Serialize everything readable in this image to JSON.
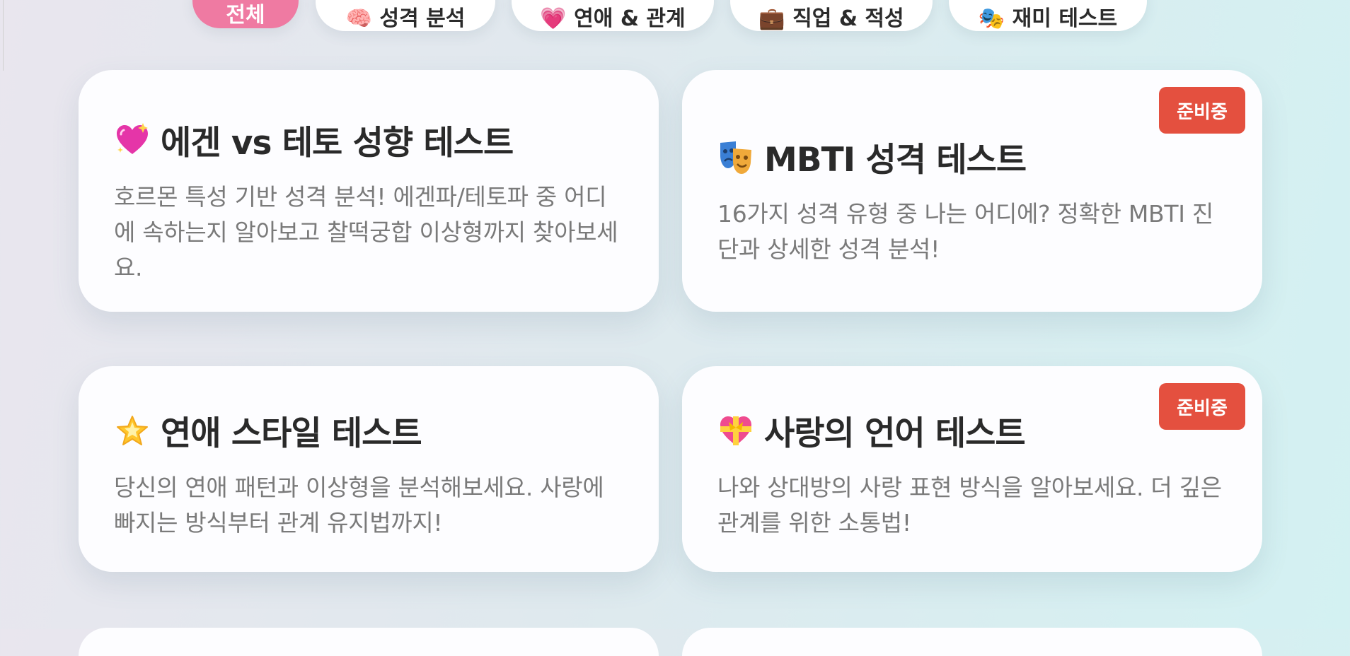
{
  "tabs": [
    {
      "label": "전체",
      "icon": "",
      "active": true
    },
    {
      "label": "🧠 성격 분석",
      "icon": "brain-icon"
    },
    {
      "label": "💗 연애 & 관계",
      "icon": "heart-icon"
    },
    {
      "label": "💼 직업 & 적성",
      "icon": "briefcase-icon"
    },
    {
      "label": "🎭 재미 테스트",
      "icon": "theater-masks-icon"
    }
  ],
  "cards": [
    {
      "icon": "sparkling-heart-icon",
      "title": "에겐 vs 테토 성향 테스트",
      "desc": "호르몬 특성 기반 성격 분석! 에겐파/테토파 중 어디에 속하는지 알아보고 찰떡궁합 이상형까지 찾아보세요."
    },
    {
      "icon": "theater-masks-icon",
      "title": "MBTI 성격 테스트",
      "desc": "16가지 성격 유형 중 나는 어디에? 정확한 MBTI 진단과 상세한 성격 분석!",
      "badge": "준비중"
    },
    {
      "icon": "glowing-star-icon",
      "title": "연애 스타일 테스트",
      "desc": "당신의 연애 패턴과 이상형을 분석해보세요. 사랑에 빠지는 방식부터 관계 유지법까지!"
    },
    {
      "icon": "heart-with-ribbon-icon",
      "title": "사랑의 언어 테스트",
      "desc": "나와 상대방의 사랑 표현 방식을 알아보세요. 더 깊은 관계를 위한 소통법!",
      "badge": "준비중"
    }
  ],
  "colors": {
    "accent": "#ef7aa2",
    "badge": "#e4503f",
    "title": "#2a2a2a",
    "desc": "#7a7a7a"
  }
}
